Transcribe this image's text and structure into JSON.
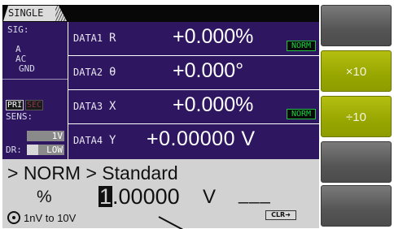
{
  "tab": {
    "label": "SINGLE"
  },
  "status": {
    "sig_label": "SIG:",
    "sig_values": [
      "A",
      "AC",
      "GND"
    ],
    "pri_label": "PRI",
    "sec_label": "SEC",
    "sens_label": "SENS:",
    "sens_value": "1V",
    "dr_label": "DR:",
    "dr_value": "LOW"
  },
  "data_rows": [
    {
      "name": "DATA1",
      "symbol": "R",
      "value": "+0.000%",
      "badge": "NORM"
    },
    {
      "name": "DATA2",
      "symbol": "θ",
      "value": "+0.000°",
      "badge": ""
    },
    {
      "name": "DATA3",
      "symbol": "X",
      "value": "+0.000%",
      "badge": "NORM"
    },
    {
      "name": "DATA4",
      "symbol": "Y",
      "value": "+0.00000 V",
      "badge": ""
    }
  ],
  "entry": {
    "breadcrumb": "> NORM > Standard",
    "unit_prefix": "%",
    "cursor_digit": "1",
    "value_rest": ".00000",
    "unit": "V",
    "dashes": "___",
    "clr_label": "CLR➜",
    "range_text": "1nV to 10V"
  },
  "softkeys": [
    {
      "label": "",
      "style": "gray"
    },
    {
      "label": "×10",
      "style": "green"
    },
    {
      "label": "÷10",
      "style": "green"
    },
    {
      "label": "",
      "style": "gray"
    },
    {
      "label": "",
      "style": "gray"
    }
  ],
  "colors": {
    "panel": "#2e1760",
    "norm_badge": "#20d040",
    "softkey_green": "#98a600",
    "softkey_gray": "#555555",
    "entry_bg": "#d2d2d2"
  }
}
